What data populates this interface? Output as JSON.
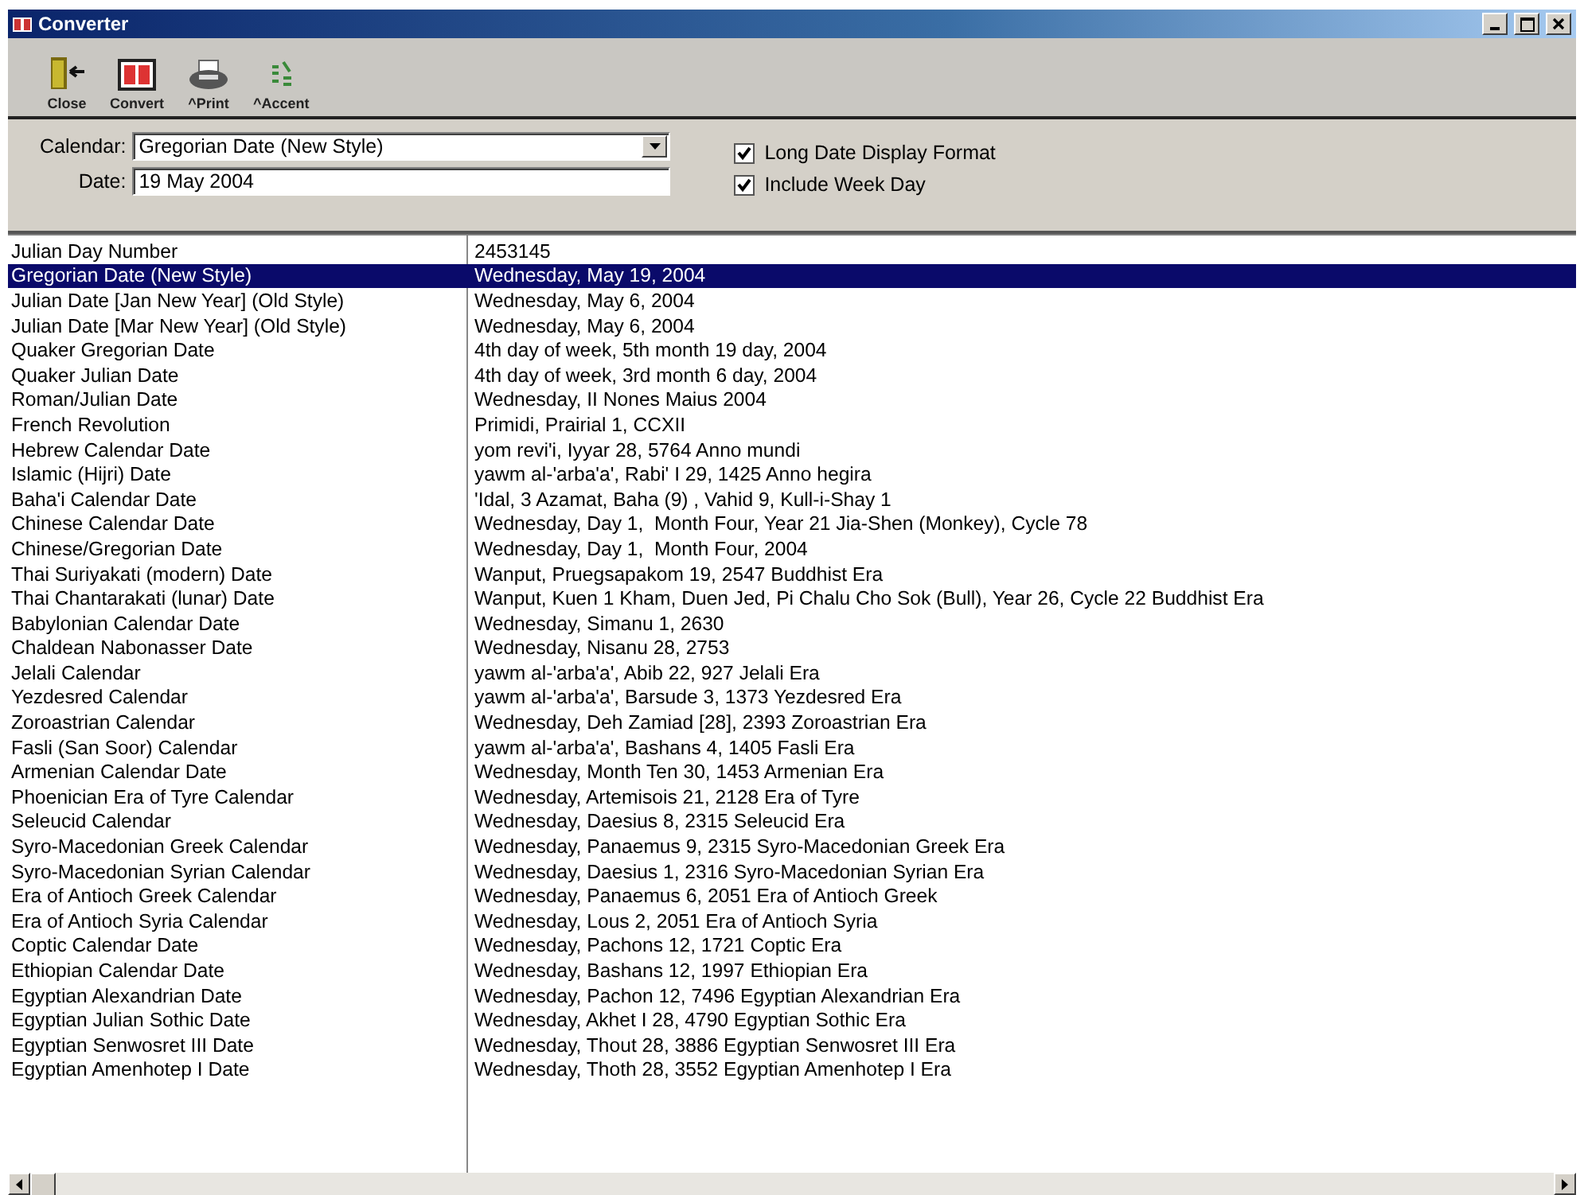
{
  "window": {
    "title": "Converter"
  },
  "toolbar": [
    {
      "kind": "close",
      "label": "Close"
    },
    {
      "kind": "convert",
      "label": "Convert"
    },
    {
      "kind": "print",
      "label": "^Print"
    },
    {
      "kind": "accent",
      "label": "^Accent"
    }
  ],
  "form": {
    "calendar_label": "Calendar:",
    "calendar_value": "Gregorian Date (New Style)",
    "date_label": "Date:",
    "date_value": "19 May 2004",
    "options": [
      {
        "label": "Long Date Display Format",
        "checked": true
      },
      {
        "label": "Include Week Day",
        "checked": true
      }
    ]
  },
  "table": {
    "rows": [
      {
        "name": "Julian Day Number",
        "value": "2453145",
        "selected": false
      },
      {
        "name": "Gregorian Date (New Style)",
        "value": "Wednesday, May 19, 2004",
        "selected": true
      },
      {
        "name": "Julian Date [Jan New Year] (Old Style)",
        "value": "Wednesday, May 6, 2004",
        "selected": false
      },
      {
        "name": "Julian Date [Mar New Year] (Old Style)",
        "value": "Wednesday, May 6, 2004",
        "selected": false
      },
      {
        "name": "Quaker Gregorian Date",
        "value": "4th day of week, 5th month 19 day, 2004",
        "selected": false
      },
      {
        "name": "Quaker Julian Date",
        "value": "4th day of week, 3rd month 6 day, 2004",
        "selected": false
      },
      {
        "name": "Roman/Julian Date",
        "value": "Wednesday, II Nones Maius 2004",
        "selected": false
      },
      {
        "name": "French Revolution",
        "value": "Primidi, Prairial 1, CCXII",
        "selected": false
      },
      {
        "name": "Hebrew Calendar Date",
        "value": "yom revi'i, Iyyar 28, 5764 Anno mundi",
        "selected": false
      },
      {
        "name": "Islamic (Hijri) Date",
        "value": "yawm al-'arba'a', Rabi' I 29, 1425 Anno hegira",
        "selected": false
      },
      {
        "name": "Baha'i Calendar Date",
        "value": "'Idal, 3 Azamat, Baha (9) , Vahid 9, Kull-i-Shay 1",
        "selected": false
      },
      {
        "name": "Chinese Calendar Date",
        "value": "Wednesday, Day 1,  Month Four, Year 21 Jia-Shen (Monkey), Cycle 78",
        "selected": false
      },
      {
        "name": "Chinese/Gregorian Date",
        "value": "Wednesday, Day 1,  Month Four, 2004",
        "selected": false
      },
      {
        "name": "Thai Suriyakati (modern) Date",
        "value": "Wanput, Pruegsapakom 19, 2547 Buddhist Era",
        "selected": false
      },
      {
        "name": "Thai Chantarakati (lunar) Date",
        "value": "Wanput, Kuen 1 Kham, Duen Jed, Pi Chalu Cho Sok (Bull), Year 26, Cycle 22 Buddhist Era",
        "selected": false
      },
      {
        "name": "Babylonian Calendar Date",
        "value": "Wednesday, Simanu 1, 2630",
        "selected": false
      },
      {
        "name": "Chaldean Nabonasser Date",
        "value": "Wednesday, Nisanu 28, 2753",
        "selected": false
      },
      {
        "name": "Jelali Calendar",
        "value": "yawm al-'arba'a', Abib 22, 927 Jelali Era",
        "selected": false
      },
      {
        "name": "Yezdesred Calendar",
        "value": "yawm al-'arba'a', Barsude 3, 1373 Yezdesred Era",
        "selected": false
      },
      {
        "name": "Zoroastrian Calendar",
        "value": "Wednesday, Deh Zamiad [28], 2393 Zoroastrian Era",
        "selected": false
      },
      {
        "name": "Fasli (San Soor) Calendar",
        "value": "yawm al-'arba'a', Bashans 4, 1405 Fasli Era",
        "selected": false
      },
      {
        "name": "Armenian Calendar Date",
        "value": "Wednesday, Month Ten 30, 1453 Armenian Era",
        "selected": false
      },
      {
        "name": "Phoenician Era of Tyre Calendar",
        "value": "Wednesday, Artemisois 21, 2128 Era of Tyre",
        "selected": false
      },
      {
        "name": "Seleucid Calendar",
        "value": "Wednesday, Daesius 8, 2315 Seleucid Era",
        "selected": false
      },
      {
        "name": "Syro-Macedonian Greek Calendar",
        "value": "Wednesday, Panaemus 9, 2315 Syro-Macedonian Greek Era",
        "selected": false
      },
      {
        "name": "Syro-Macedonian Syrian Calendar",
        "value": "Wednesday, Daesius 1, 2316 Syro-Macedonian Syrian Era",
        "selected": false
      },
      {
        "name": "Era of Antioch Greek Calendar",
        "value": "Wednesday, Panaemus 6, 2051 Era of Antioch Greek",
        "selected": false
      },
      {
        "name": "Era of Antioch Syria Calendar",
        "value": "Wednesday, Lous 2, 2051 Era of Antioch Syria",
        "selected": false
      },
      {
        "name": "Coptic Calendar Date",
        "value": "Wednesday, Pachons 12, 1721 Coptic Era",
        "selected": false
      },
      {
        "name": "Ethiopian Calendar Date",
        "value": "Wednesday, Bashans 12, 1997 Ethiopian Era",
        "selected": false
      },
      {
        "name": "Egyptian Alexandrian Date",
        "value": "Wednesday, Pachon 12, 7496 Egyptian Alexandrian Era",
        "selected": false
      },
      {
        "name": "Egyptian Julian Sothic Date",
        "value": "Wednesday, Akhet I 28, 4790 Egyptian Sothic Era",
        "selected": false
      },
      {
        "name": "Egyptian Senwosret III Date",
        "value": "Wednesday, Thout 28, 3886 Egyptian Senwosret III Era",
        "selected": false
      },
      {
        "name": "Egyptian Amenhotep I Date",
        "value": "Wednesday, Thoth 28, 3552 Egyptian Amenhotep I Era",
        "selected": false
      }
    ]
  }
}
